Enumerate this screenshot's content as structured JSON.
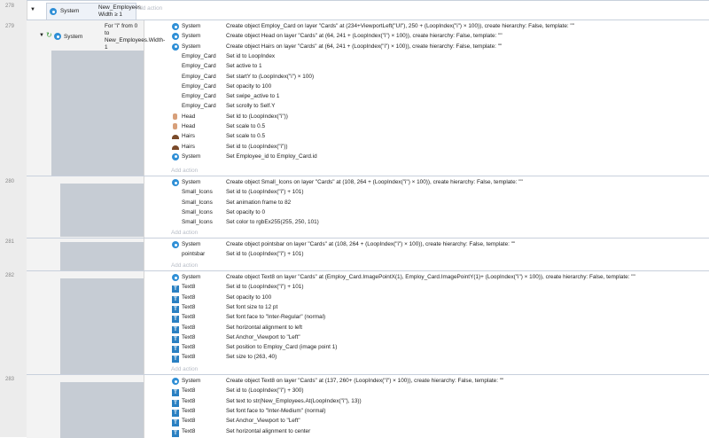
{
  "lines": {
    "n278": "278",
    "n279": "279",
    "n280": "280",
    "n281": "281",
    "n282": "282",
    "n283": "283"
  },
  "ev278": {
    "cond_obj": "System",
    "cond_text": "New_Employees.\nWidth ≥ 1",
    "add_action": "Add action"
  },
  "ev279": {
    "cond_obj": "System",
    "cond_text": "For \"i\" from 0 to New_Employees.Width-1",
    "add_action": "Add action"
  },
  "actions279": [
    {
      "obj": "System",
      "icon": "system",
      "text": "Create object Employ_Card on layer \"Cards\" at (234+ViewportLeft(\"UI\"), 250 + (LoopIndex(\"i\") × 100)), create hierarchy: False, template: \"\""
    },
    {
      "obj": "System",
      "icon": "system",
      "text": "Create object Head on layer \"Cards\" at (64, 241 + (LoopIndex(\"i\") × 100)), create hierarchy: False, template: \"\""
    },
    {
      "obj": "System",
      "icon": "system",
      "text": "Create object Hairs on layer \"Cards\" at (64, 241 + (LoopIndex(\"i\") × 100)), create hierarchy: False, template: \"\""
    },
    {
      "obj": "Employ_Card",
      "icon": "",
      "text": "Set id to LoopIndex"
    },
    {
      "obj": "Employ_Card",
      "icon": "",
      "text": "Set active to 1"
    },
    {
      "obj": "Employ_Card",
      "icon": "",
      "text": "Set startY to (LoopIndex(\"i\") × 100)"
    },
    {
      "obj": "Employ_Card",
      "icon": "",
      "text": "Set opacity to 100"
    },
    {
      "obj": "Employ_Card",
      "icon": "",
      "text": "Set swipe_active to 1"
    },
    {
      "obj": "Employ_Card",
      "icon": "",
      "text": "Set scrolly to Self.Y"
    },
    {
      "obj": "Head",
      "icon": "head",
      "text": "Set Id to (LoopIndex(\"i\"))"
    },
    {
      "obj": "Head",
      "icon": "head",
      "text": "Set scale to 0.5"
    },
    {
      "obj": "Hairs",
      "icon": "hairs",
      "text": "Set scale to 0.5"
    },
    {
      "obj": "Hairs",
      "icon": "hairs",
      "text": "Set id to (LoopIndex(\"i\"))"
    },
    {
      "obj": "System",
      "icon": "system",
      "text": "Set Employee_id to Employ_Card.id"
    }
  ],
  "actions280": [
    {
      "obj": "System",
      "icon": "system",
      "text": "Create object Small_Icons on layer \"Cards\" at (108, 264 + (LoopIndex(\"i\") × 100)), create hierarchy: False, template: \"\""
    },
    {
      "obj": "Small_Icons",
      "icon": "",
      "text": "Set id to (LoopIndex(\"i\") + 101)"
    },
    {
      "obj": "Small_Icons",
      "icon": "",
      "text": "Set animation frame to 82"
    },
    {
      "obj": "Small_Icons",
      "icon": "",
      "text": "Set opacity to 0"
    },
    {
      "obj": "Small_Icons",
      "icon": "",
      "text": "Set color to rgbEx255(255, 250, 101)"
    }
  ],
  "actions281": [
    {
      "obj": "System",
      "icon": "system",
      "text": "Create object pointsbar on layer \"Cards\" at (108, 264 + (LoopIndex(\"i\") × 100)), create hierarchy: False, template: \"\""
    },
    {
      "obj": "pointsbar",
      "icon": "",
      "text": "Set id to (LoopIndex(\"i\") + 101)"
    }
  ],
  "actions282": [
    {
      "obj": "System",
      "icon": "system",
      "text": "Create object Text8 on layer \"Cards\" at (Employ_Card.ImagePointX(1), Employ_Card.ImagePointY(1)+ (LoopIndex(\"i\") × 100)), create hierarchy: False, template: \"\""
    },
    {
      "obj": "Text8",
      "icon": "text",
      "text": "Set id to (LoopIndex(\"i\") + 101)"
    },
    {
      "obj": "Text8",
      "icon": "text",
      "text": "Set opacity to 100"
    },
    {
      "obj": "Text8",
      "icon": "text",
      "text": "Set font size to 12 pt"
    },
    {
      "obj": "Text8",
      "icon": "text",
      "text": "Set font face to \"Inter-Regular\" (normal)"
    },
    {
      "obj": "Text8",
      "icon": "text",
      "text": "Set horizontal alignment to left"
    },
    {
      "obj": "Text8",
      "icon": "text",
      "text": "Set Anchor_Viewport to \"Left\""
    },
    {
      "obj": "Text8",
      "icon": "text",
      "text": "Set position to Employ_Card (image point 1)"
    },
    {
      "obj": "Text8",
      "icon": "text",
      "text": "Set size to (263, 40)"
    }
  ],
  "actions283": [
    {
      "obj": "System",
      "icon": "system",
      "text": "Create object Text8 on layer \"Cards\" at (137, 260+ (LoopIndex(\"i\") × 100)), create hierarchy: False, template: \"\""
    },
    {
      "obj": "Text8",
      "icon": "text",
      "text": "Set id to (LoopIndex(\"i\") + 300)"
    },
    {
      "obj": "Text8",
      "icon": "text",
      "text": "Set text to str(New_Employees.At(LoopIndex(\"i\"), 13))"
    },
    {
      "obj": "Text8",
      "icon": "text",
      "text": "Set font face to \"Inter-Medium\" (normal)"
    },
    {
      "obj": "Text8",
      "icon": "text",
      "text": "Set Anchor_Viewport to \"Left\""
    },
    {
      "obj": "Text8",
      "icon": "text",
      "text": "Set horizontal alignment to center"
    }
  ],
  "add_action": "Add action"
}
